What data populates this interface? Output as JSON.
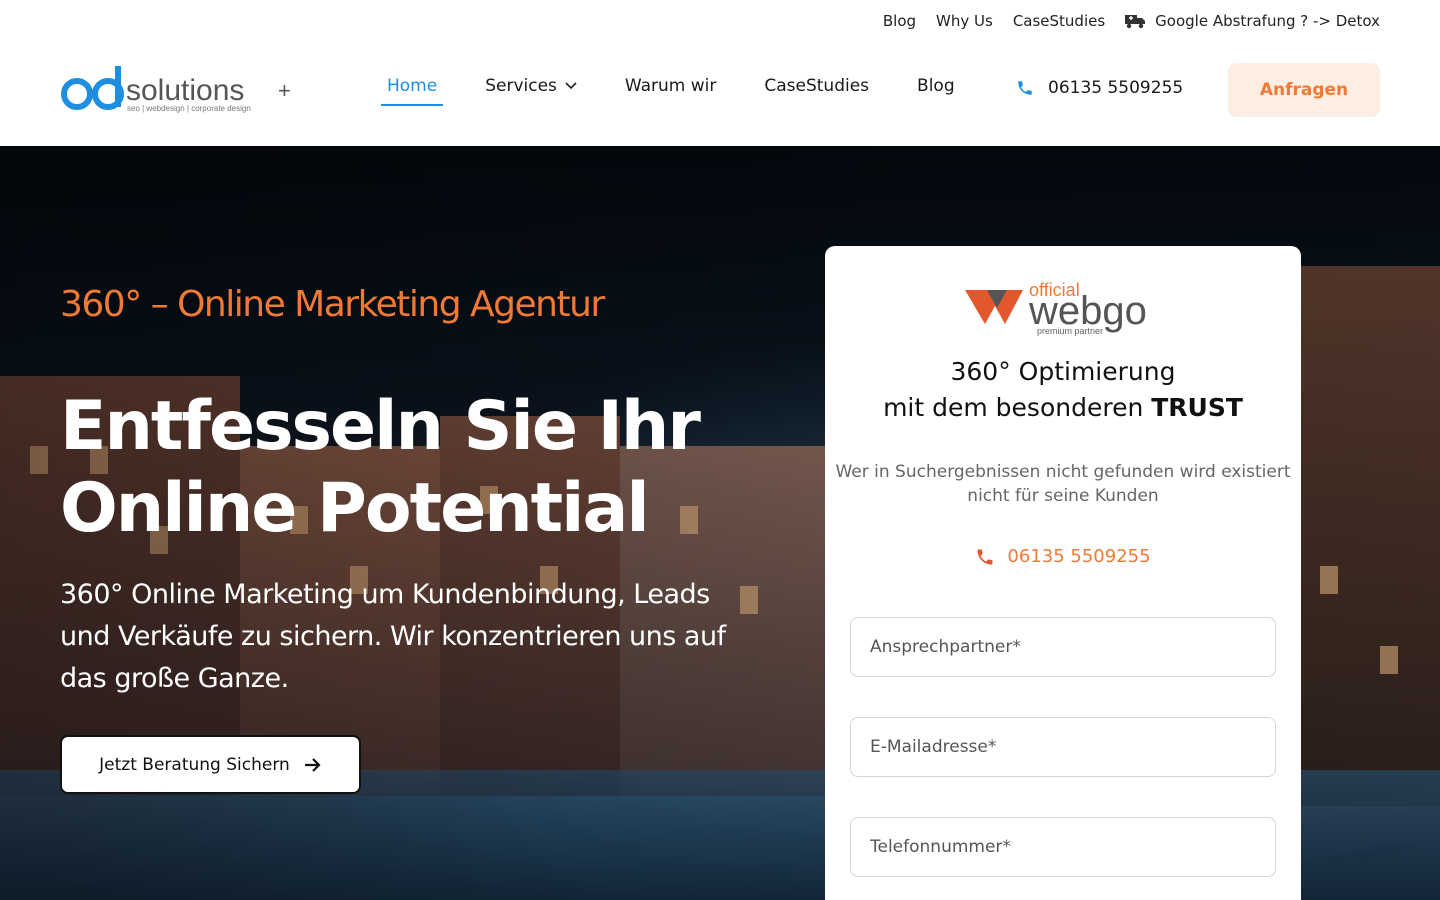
{
  "topbar": {
    "links": [
      "Blog",
      "Why Us",
      "CaseStudies"
    ],
    "detox_link": "Google Abstrafung ? -> Detox"
  },
  "logo": {
    "brand": "solutions+",
    "tagline": "seo | webdesign | corporate design"
  },
  "nav": {
    "items": [
      {
        "label": "Home",
        "active": true
      },
      {
        "label": "Services",
        "dropdown": true
      },
      {
        "label": "Warum wir"
      },
      {
        "label": "CaseStudies"
      },
      {
        "label": "Blog"
      }
    ],
    "phone": "06135 5509255",
    "cta": "Anfragen"
  },
  "hero": {
    "tagline": "360° –  Online Marketing Agentur",
    "headline_line1": "Entfesseln Sie Ihr",
    "headline_line2": "Online Potential",
    "subtext": "360° Online Marketing um Kundenbindung, Leads und Verkäufe zu sichern. Wir konzentrieren uns auf das große Ganze.",
    "cta": "Jetzt Beratung Sichern"
  },
  "card": {
    "badge_official": "official",
    "badge_brand": "webgo",
    "badge_partner": "premium partner",
    "title_line1": "360° Optimierung",
    "title_line2_prefix": "mit dem besonderen",
    "title_line2_bold": "TRUST",
    "subtitle": "Wer in Suchergebnissen nicht gefunden wird existiert nicht für seine Kunden",
    "phone": "06135 5509255",
    "fields": {
      "contact_placeholder": "Ansprechpartner*",
      "email_placeholder": "E-Mailadresse*",
      "phone_placeholder": "Telefonnummer*"
    }
  },
  "colors": {
    "accent_orange": "#f07a35",
    "accent_blue": "#1e8fe0",
    "cta_bg": "#fdeee4"
  }
}
